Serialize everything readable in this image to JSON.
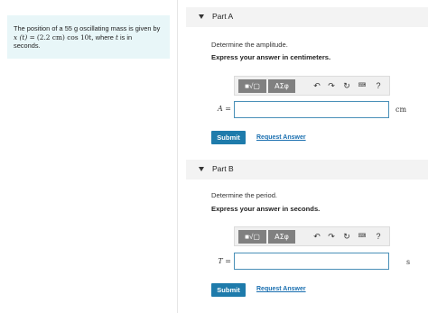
{
  "problem": {
    "text_before": "The position of a 55",
    "mass_unit": "g",
    "text_after_mass": "oscillating mass is given by",
    "lhs": "x (t) =",
    "expression": "(2.2 cm) cos 10t,",
    "text_where": "where",
    "var_t": "t",
    "text_is_in": "is in",
    "text_seconds": "seconds."
  },
  "parts": [
    {
      "title": "Part A",
      "prompt": "Determine the amplitude.",
      "instruction": "Express your answer in centimeters.",
      "variable": "A",
      "equals": "=",
      "input_value": "",
      "unit": "cm",
      "submit_label": "Submit",
      "request_label": "Request Answer"
    },
    {
      "title": "Part B",
      "prompt": "Determine the period.",
      "instruction": "Express your answer in seconds.",
      "variable": "T",
      "equals": "=",
      "input_value": "",
      "unit": "s",
      "submit_label": "Submit",
      "request_label": "Request Answer"
    }
  ],
  "toolbar": {
    "templates_label": "■√▢",
    "symbols_label": "ΑΣφ",
    "undo_icon": "↶",
    "redo_icon": "↷",
    "reset_icon": "↻",
    "keyboard_icon": "⌨",
    "help_label": "?"
  },
  "colors": {
    "problem_bg": "#e8f6f8",
    "accent": "#1e7bab",
    "link": "#1a6fb0",
    "input_border": "#4a90b8"
  }
}
